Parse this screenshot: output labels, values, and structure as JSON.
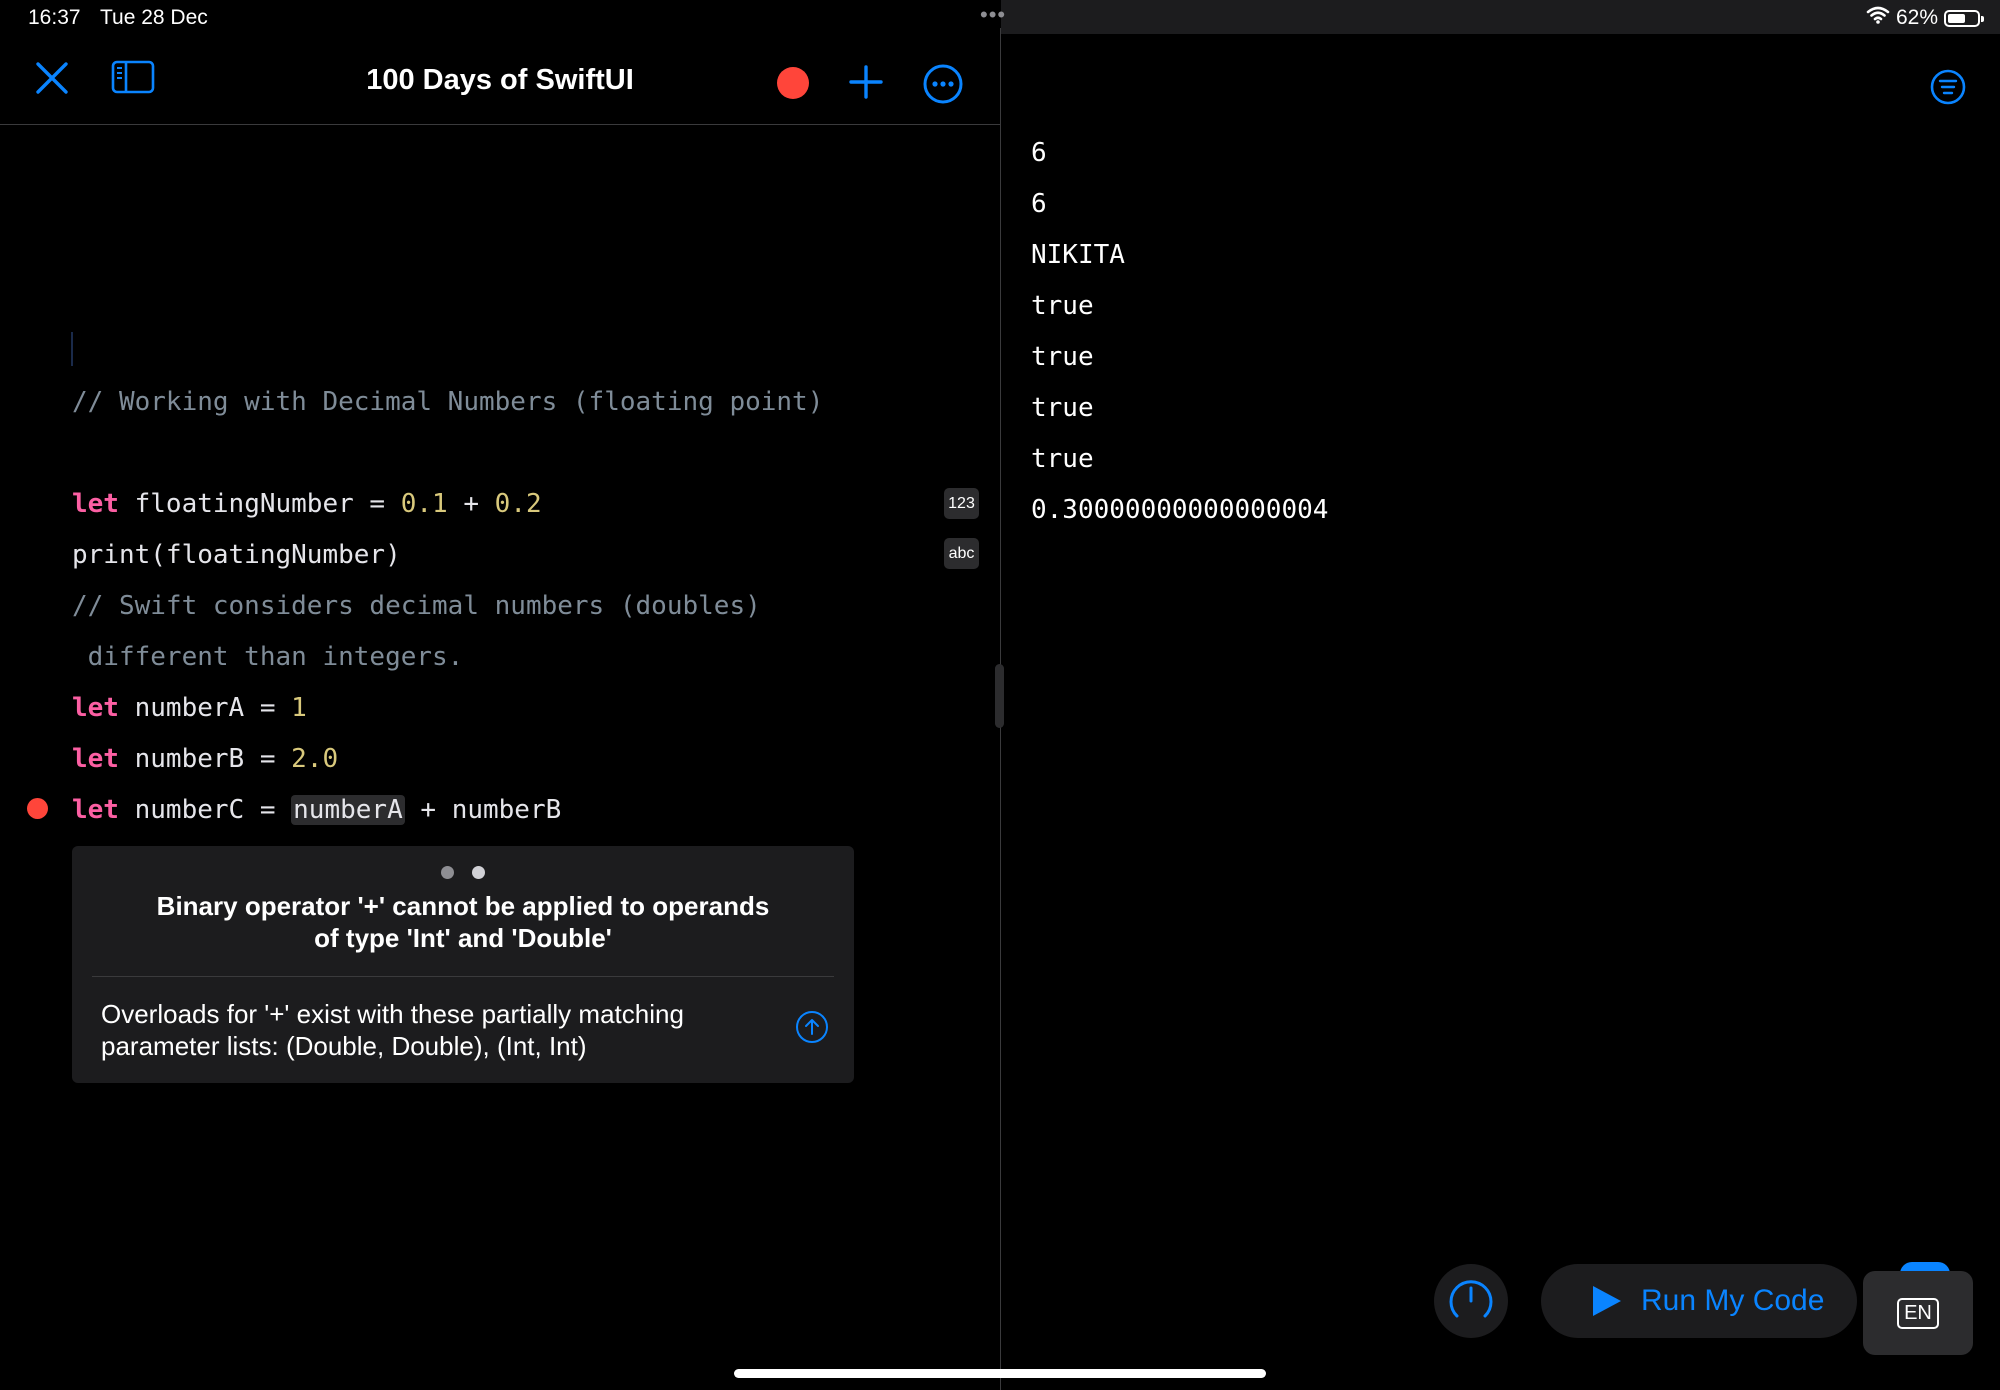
{
  "status": {
    "time": "16:37",
    "date": "Tue 28 Dec",
    "multitask_dots": "•••",
    "battery_pct": "62%",
    "battery_level": 0.62
  },
  "toolbar": {
    "title": "100 Days of SwiftUI",
    "icons": [
      "close-icon",
      "sidebar-icon",
      "record-icon",
      "plus-icon",
      "more-icon"
    ]
  },
  "code": {
    "comment1": "// Working with Decimal Numbers (floating point)",
    "line1": {
      "kw": "let",
      "name": " floatingNumber = ",
      "n1": "0.1",
      "op": " + ",
      "n2": "0.2"
    },
    "line2": "print(floatingNumber)",
    "comment2a": "// Swift considers decimal numbers (doubles)",
    "comment2b": " different than integers.",
    "line3": {
      "kw": "let",
      "name": " numberA = ",
      "val": "1"
    },
    "line4": {
      "kw": "let",
      "name": " numberB = ",
      "val": "2.0"
    },
    "line5": {
      "kw": "let",
      "name": " numberC = ",
      "hl": "numberA",
      "rest": " + numberB"
    },
    "badge_num": "123",
    "badge_abc": "abc"
  },
  "error": {
    "title": "Binary operator '+' cannot be applied to operands of type 'Int' and 'Double'",
    "title_line1": "Binary operator '+' cannot be applied to operands",
    "title_line2": "of type 'Int' and 'Double'",
    "body_line1": "Overloads for '+' exist with these partially matching",
    "body_line2": "parameter lists: (Double, Double), (Int, Int)",
    "pages": 2,
    "active_page": 2
  },
  "output": {
    "lines": [
      "6",
      "6",
      "NIKITA",
      "true",
      "true",
      "true",
      "true",
      "0.30000000000000004"
    ]
  },
  "bottom": {
    "run_label": "Run My Code",
    "keyboard_lang": "EN"
  },
  "colors": {
    "accent": "#0a84ff",
    "keyword": "#fc5fa3",
    "number": "#d9c97c",
    "comment": "#7f8c98",
    "error_red": "#ff453a"
  }
}
